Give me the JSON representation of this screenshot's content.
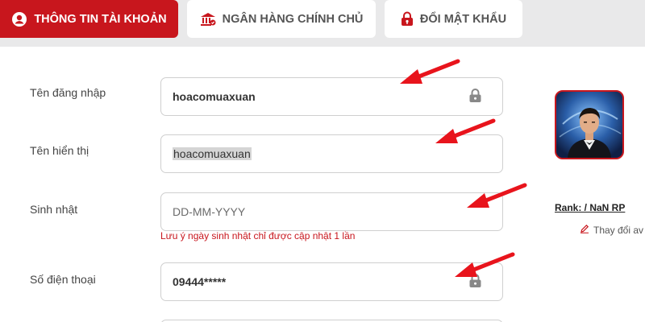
{
  "tabs": [
    {
      "label": "THÔNG TIN TÀI KHOẢN",
      "icon": "user-circle-icon",
      "active": true
    },
    {
      "label": "NGÂN HÀNG CHÍNH CHỦ",
      "icon": "bank-icon",
      "active": false
    },
    {
      "label": "ĐỔI MẬT KHẨU",
      "icon": "lock-icon",
      "active": false
    }
  ],
  "form": {
    "username": {
      "label": "Tên đăng nhập",
      "value": "hoacomuaxuan",
      "locked": true
    },
    "display_name": {
      "label": "Tên hiển thị",
      "value": "hoacomuaxuan"
    },
    "birthday": {
      "label": "Sinh nhật",
      "placeholder": "DD-MM-YYYY",
      "hint": "Lưu ý ngày sinh nhật chỉ được cập nhật 1 lần"
    },
    "phone": {
      "label": "Số điện thoại",
      "value": "09444*****",
      "locked": true
    }
  },
  "profile": {
    "rank_text": "Rank: / NaN RP",
    "change_avatar_label": "Thay đổi av"
  },
  "colors": {
    "accent": "#c8161d",
    "tab_bar": "#e9e9ea",
    "arrow": "#e8141c"
  }
}
